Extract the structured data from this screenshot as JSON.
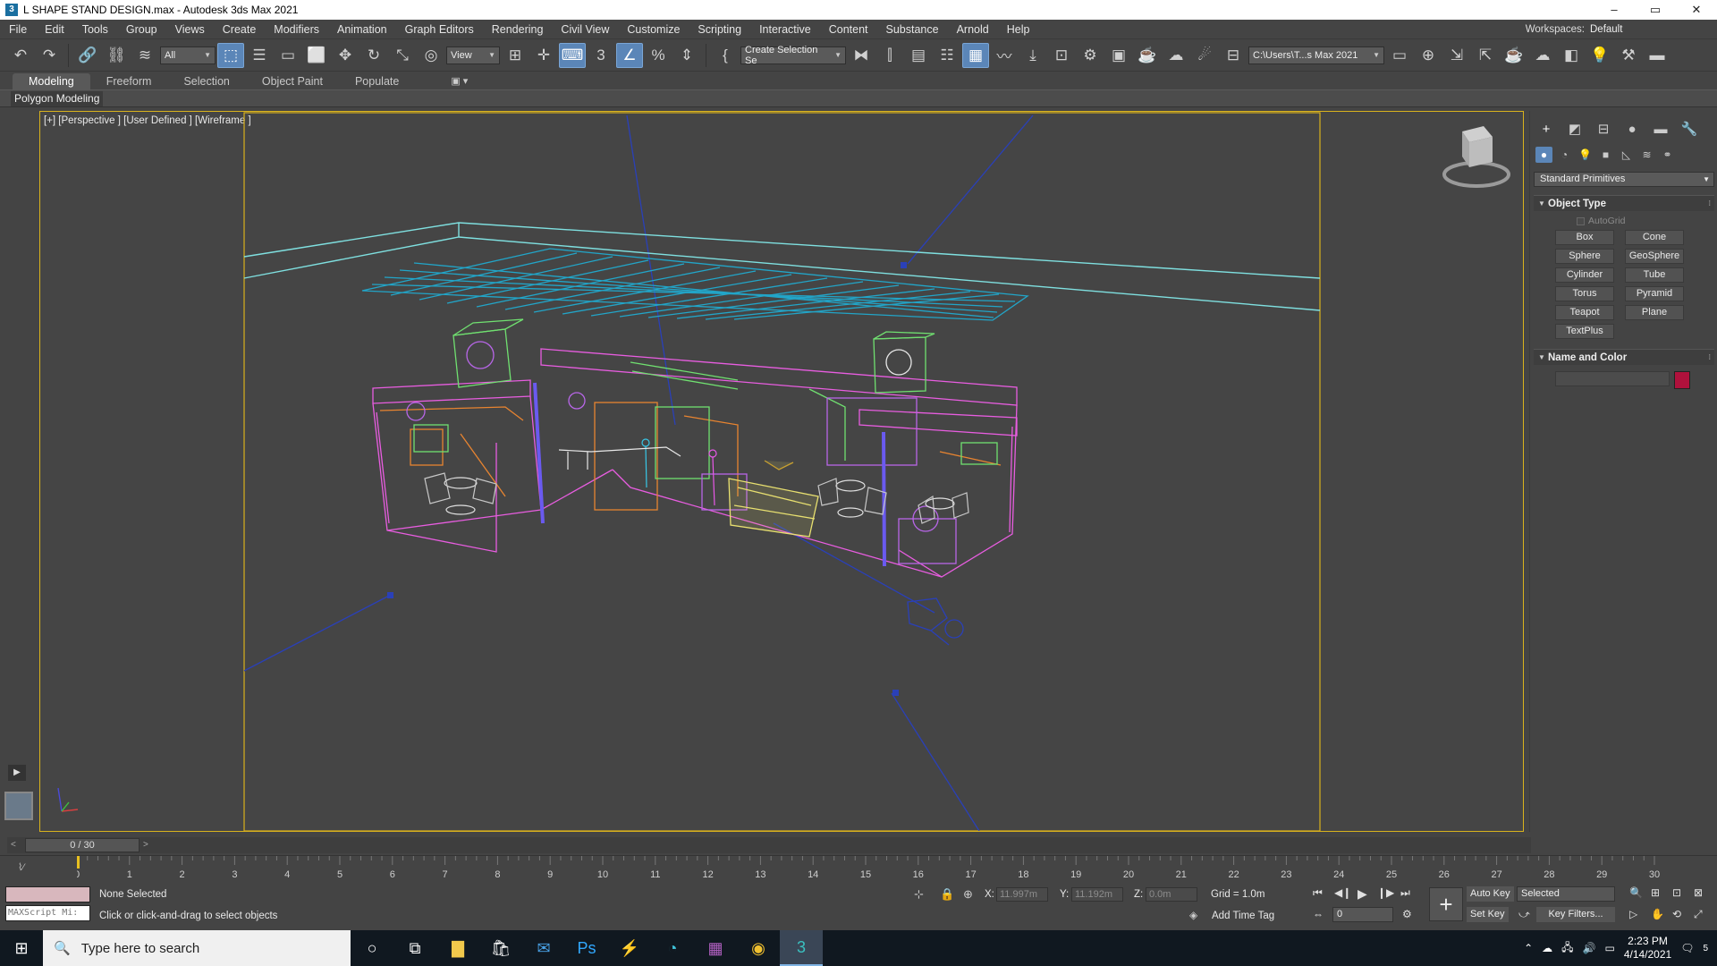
{
  "window": {
    "title": "L SHAPE STAND DESIGN.max - Autodesk 3ds Max 2021",
    "app_icon": "3",
    "controls": [
      "–",
      "▭",
      "✕"
    ]
  },
  "menu": [
    "File",
    "Edit",
    "Tools",
    "Group",
    "Views",
    "Create",
    "Modifiers",
    "Animation",
    "Graph Editors",
    "Rendering",
    "Civil View",
    "Customize",
    "Scripting",
    "Interactive",
    "Content",
    "Substance",
    "Arnold",
    "Help"
  ],
  "workspace": {
    "label": "Workspaces:",
    "value": "Default"
  },
  "toolbar": {
    "filter_value": "All",
    "ref_coord_value": "View",
    "selection_set_value": "Create Selection Se",
    "project_path": "C:\\Users\\T...s Max 2021"
  },
  "ribbon": {
    "tabs": [
      "Modeling",
      "Freeform",
      "Selection",
      "Object Paint",
      "Populate"
    ],
    "active_tab": "Modeling",
    "panel_label": "Polygon Modeling"
  },
  "viewport": {
    "label": "[+] [Perspective ] [User Defined ] [Wireframe ]",
    "border_color": "#d9b21d",
    "wire_colors": {
      "floor_grid": "#22a5c8",
      "walls": "#e85de0",
      "accent_green": "#70e070",
      "accent_orange": "#e88430",
      "accent_yellow": "#e8e070",
      "camera_lines": "#2a40b8",
      "pillar": "#6a5af0"
    }
  },
  "command_panel": {
    "category_value": "Standard Primitives",
    "object_type_title": "Object Type",
    "autogrid_label": "AutoGrid",
    "buttons": [
      "Box",
      "Cone",
      "Sphere",
      "GeoSphere",
      "Cylinder",
      "Tube",
      "Torus",
      "Pyramid",
      "Teapot",
      "Plane",
      "TextPlus"
    ],
    "name_color_title": "Name and Color",
    "object_color": "#b0113c"
  },
  "timeline": {
    "frame_display": "0 / 30",
    "ticks": [
      "0",
      "1",
      "2",
      "3",
      "4",
      "5",
      "6",
      "7",
      "8",
      "9",
      "10",
      "11",
      "12",
      "13",
      "14",
      "15",
      "16",
      "17",
      "18",
      "19",
      "20",
      "21",
      "22",
      "23",
      "24",
      "25",
      "26",
      "27",
      "28",
      "29",
      "30"
    ]
  },
  "status": {
    "maxscript_placeholder": "MAXScript Mi:",
    "selection": "None Selected",
    "prompt": "Click or click-and-drag to select objects",
    "x_label": "X:",
    "x_value": "11.997m",
    "y_label": "Y:",
    "y_value": "11.192m",
    "z_label": "Z:",
    "z_value": "0.0m",
    "grid": "Grid = 1.0m",
    "add_time_tag": "Add Time Tag",
    "auto_key": "Auto Key",
    "set_key": "Set Key",
    "key_mode_value": "Selected",
    "key_filters": "Key Filters...",
    "current_frame": "0"
  },
  "taskbar": {
    "search_placeholder": "Type here to search",
    "time": "2:23 PM",
    "date": "4/14/2021",
    "notifications": "5"
  }
}
